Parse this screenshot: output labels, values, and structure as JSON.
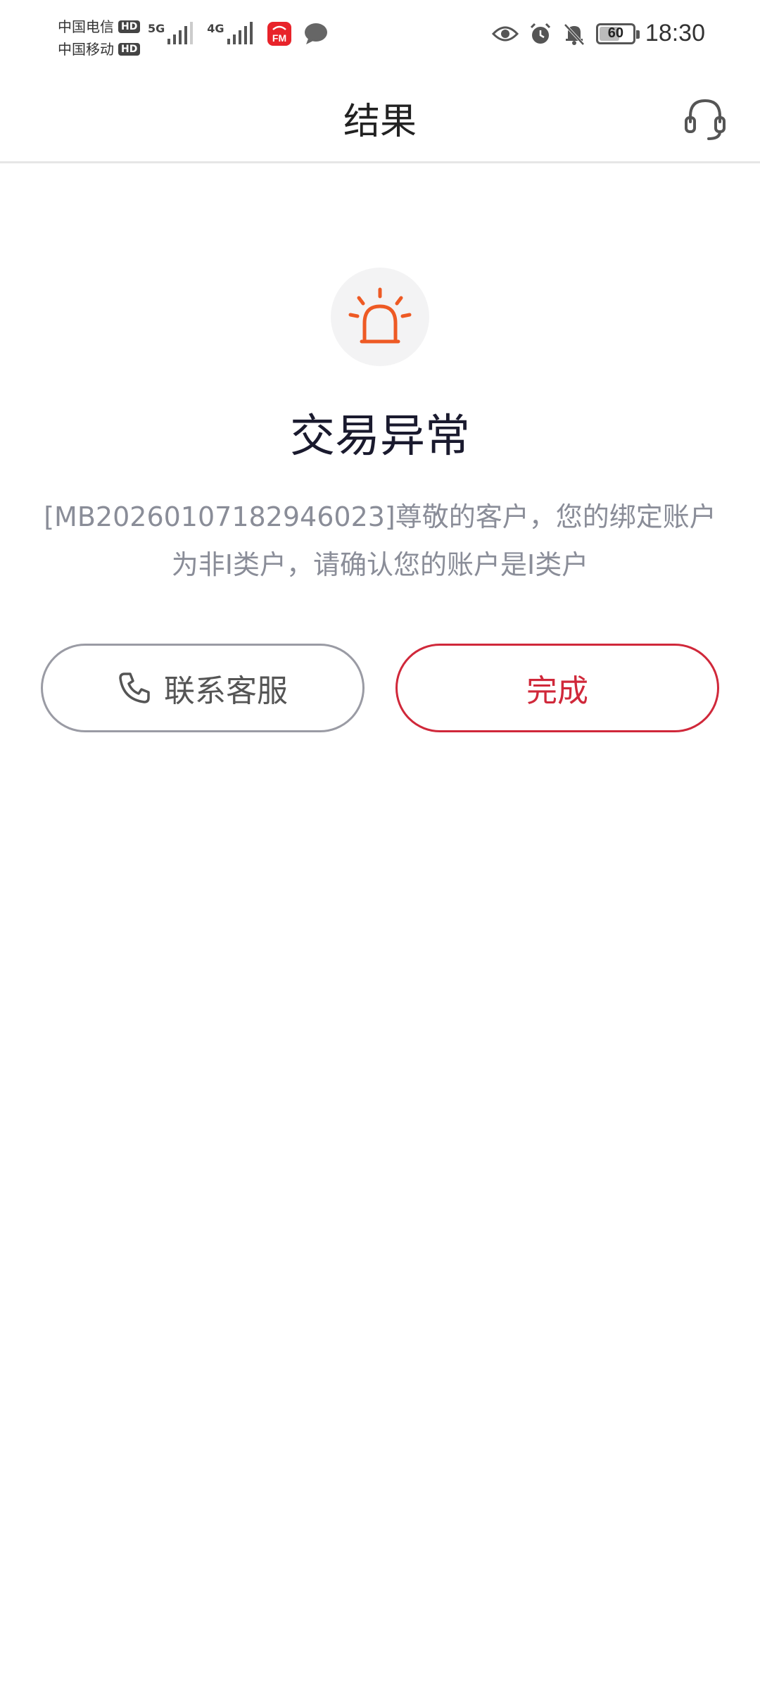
{
  "status_bar": {
    "carrier_1": "中国电信",
    "carrier_2": "中国移动",
    "hd_label": "HD",
    "network_1": "5G",
    "network_2": "4G",
    "battery_level": "60",
    "time": "18:30"
  },
  "header": {
    "title": "结果"
  },
  "result": {
    "title": "交易异常",
    "message": "[MB20260107182946023]尊敬的客户，您的绑定账户为非I类户，请确认您的账户是I类户"
  },
  "actions": {
    "contact_label": "联系客服",
    "done_label": "完成"
  },
  "colors": {
    "alert_orange": "#ee5a24",
    "done_red": "#d0283a",
    "message_gray": "#8a8d98"
  }
}
